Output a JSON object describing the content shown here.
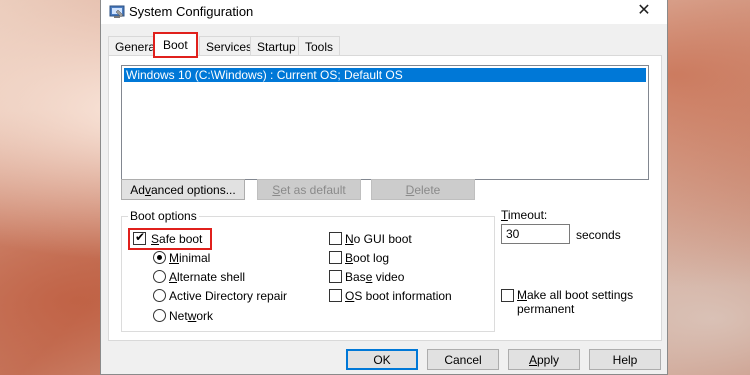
{
  "window": {
    "title": "System Configuration",
    "close_glyph": "✕",
    "app_icon": "system-configuration-icon"
  },
  "tabs": [
    {
      "label": "General",
      "active": false
    },
    {
      "label": "Boot",
      "active": true
    },
    {
      "label": "Services",
      "active": false
    },
    {
      "label": "Startup",
      "active": false
    },
    {
      "label": "Tools",
      "active": false
    }
  ],
  "boot_entries": [
    {
      "label": "Windows 10 (C:\\Windows) : Current OS; Default OS",
      "selected": true
    }
  ],
  "entry_buttons": {
    "advanced": {
      "pre": "Ad",
      "u": "v",
      "post": "anced options...",
      "enabled": true
    },
    "set_default": {
      "pre": "",
      "u": "S",
      "post": "et as default",
      "enabled": false
    },
    "delete": {
      "pre": "",
      "u": "D",
      "post": "elete",
      "enabled": false
    }
  },
  "boot_options": {
    "group_label": "Boot options",
    "safe_boot": {
      "pre": "",
      "u": "S",
      "post": "afe boot",
      "checked": true
    },
    "minimal": {
      "pre": "",
      "u": "M",
      "post": "inimal",
      "selected": true
    },
    "alternate_shell": {
      "pre": "",
      "u": "A",
      "post": "lternate shell",
      "selected": false
    },
    "ad_repair": {
      "pre": "Active Directory repair",
      "u": "",
      "post": "",
      "selected": false
    },
    "network": {
      "pre": "Net",
      "u": "w",
      "post": "ork",
      "selected": false
    },
    "no_gui": {
      "pre": "",
      "u": "N",
      "post": "o GUI boot",
      "checked": false
    },
    "boot_log": {
      "pre": "",
      "u": "B",
      "post": "oot log",
      "checked": false
    },
    "base_video": {
      "pre": "Bas",
      "u": "e",
      "post": " video",
      "checked": false
    },
    "os_info": {
      "pre": "",
      "u": "O",
      "post": "S boot information",
      "checked": false
    }
  },
  "timeout": {
    "label_pre": "",
    "label_u": "T",
    "label_post": "imeout:",
    "value": "30",
    "unit": "seconds"
  },
  "permanent": {
    "pre": "",
    "u": "M",
    "post": "ake all boot settings",
    "line2": "permanent",
    "checked": false
  },
  "dialog_buttons": {
    "ok": "OK",
    "cancel": "Cancel",
    "apply_u": "A",
    "apply_post": "pply",
    "help": "Help"
  },
  "colors": {
    "selection": "#0078d7",
    "highlight_box": "#e0201c"
  }
}
